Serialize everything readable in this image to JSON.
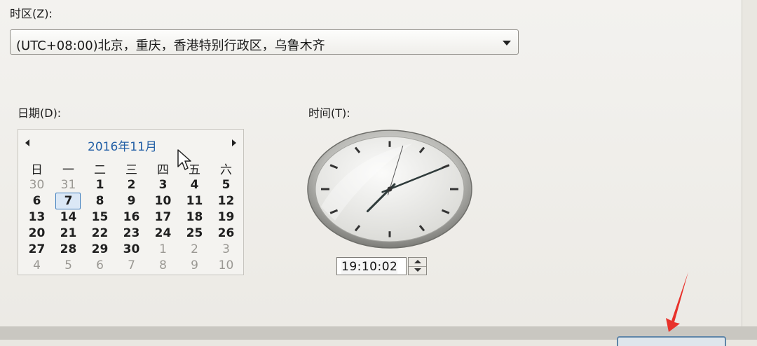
{
  "timezone": {
    "label": "时区(Z):",
    "value": "(UTC+08:00)北京，重庆，香港特别行政区，乌鲁木齐"
  },
  "date": {
    "label": "日期(D):",
    "month_title": "2016年11月",
    "weekdays": [
      "日",
      "一",
      "二",
      "三",
      "四",
      "五",
      "六"
    ],
    "weeks": [
      [
        {
          "d": "30",
          "muted": true
        },
        {
          "d": "31",
          "muted": true
        },
        {
          "d": "1"
        },
        {
          "d": "2"
        },
        {
          "d": "3"
        },
        {
          "d": "4"
        },
        {
          "d": "5"
        }
      ],
      [
        {
          "d": "6"
        },
        {
          "d": "7",
          "selected": true
        },
        {
          "d": "8"
        },
        {
          "d": "9"
        },
        {
          "d": "10"
        },
        {
          "d": "11"
        },
        {
          "d": "12"
        }
      ],
      [
        {
          "d": "13"
        },
        {
          "d": "14"
        },
        {
          "d": "15"
        },
        {
          "d": "16"
        },
        {
          "d": "17"
        },
        {
          "d": "18"
        },
        {
          "d": "19"
        }
      ],
      [
        {
          "d": "20"
        },
        {
          "d": "21"
        },
        {
          "d": "22"
        },
        {
          "d": "23"
        },
        {
          "d": "24"
        },
        {
          "d": "25"
        },
        {
          "d": "26"
        }
      ],
      [
        {
          "d": "27"
        },
        {
          "d": "28"
        },
        {
          "d": "29"
        },
        {
          "d": "30"
        },
        {
          "d": "1",
          "muted": true
        },
        {
          "d": "2",
          "muted": true
        },
        {
          "d": "3",
          "muted": true
        }
      ],
      [
        {
          "d": "4",
          "muted": true
        },
        {
          "d": "5",
          "muted": true
        },
        {
          "d": "6",
          "muted": true
        },
        {
          "d": "7",
          "muted": true
        },
        {
          "d": "8",
          "muted": true
        },
        {
          "d": "9",
          "muted": true
        },
        {
          "d": "10",
          "muted": true
        }
      ]
    ]
  },
  "time": {
    "label": "时间(T):",
    "value": "19:10:02",
    "hour": 19,
    "minute": 10,
    "second": 2
  },
  "colors": {
    "month_title": "#2460a6",
    "selection_border": "#3f7fc0",
    "annotation_arrow": "#e8322b"
  }
}
